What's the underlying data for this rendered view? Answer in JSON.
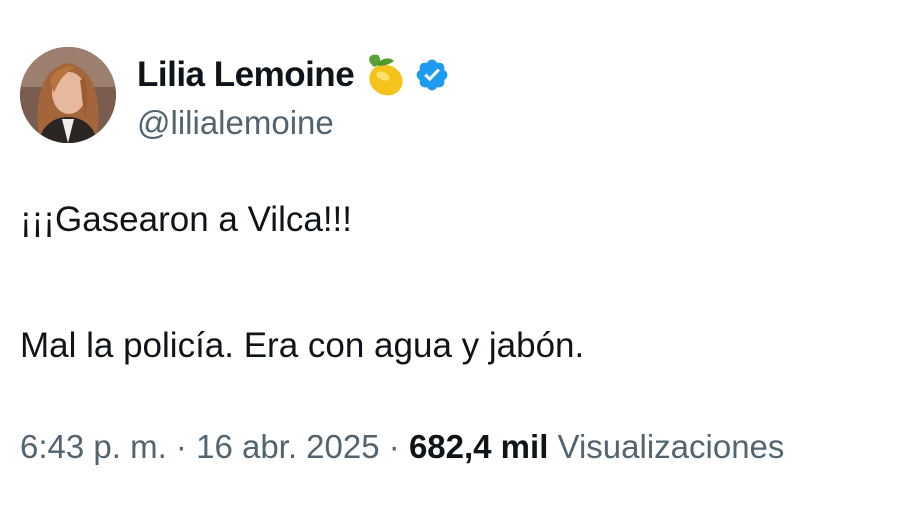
{
  "author": {
    "display_name": "Lilia Lemoine",
    "handle": "@lilialemoine",
    "badge_emoji": "lemon-icon",
    "verified": true,
    "verified_color": "#1d9bf0"
  },
  "tweet": {
    "line1": "¡¡¡Gasearon a Vilca!!!",
    "line2": "Mal la policía. Era con agua y jabón."
  },
  "meta": {
    "time": "6:43 p. m.",
    "separator": "·",
    "date": "16 abr. 2025",
    "views_count": "682,4 mil",
    "views_label": "Visualizaciones"
  },
  "colors": {
    "text_primary": "#0f1419",
    "text_secondary": "#536471",
    "background": "#ffffff"
  }
}
